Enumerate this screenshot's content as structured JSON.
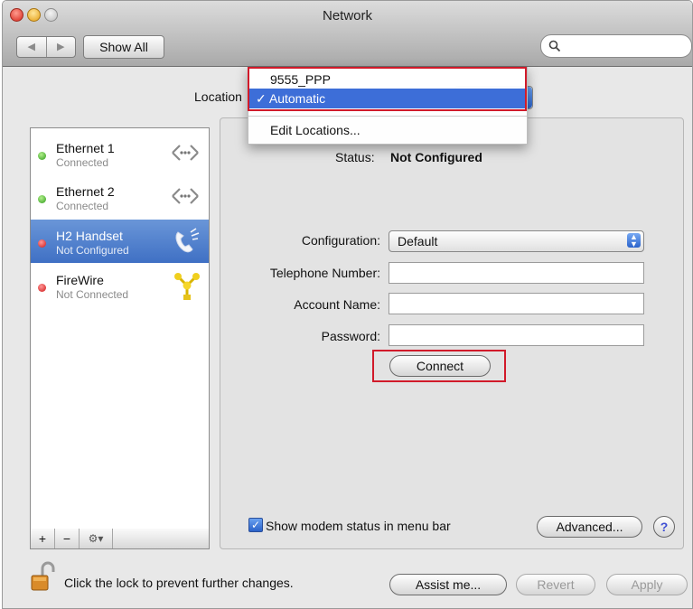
{
  "window": {
    "title": "Network"
  },
  "toolbar": {
    "back": "◀",
    "forward": "▶",
    "show_all": "Show All",
    "search_placeholder": ""
  },
  "location": {
    "label": "Location",
    "menu": {
      "items": [
        "9555_PPP",
        "Automatic",
        "Edit Locations..."
      ],
      "selected": "Automatic",
      "check": "✓"
    }
  },
  "sidebar": {
    "items": [
      {
        "name": "Ethernet 1",
        "status": "Connected",
        "dot": "green",
        "icon": "ethernet-icon"
      },
      {
        "name": "Ethernet 2",
        "status": "Connected",
        "dot": "green",
        "icon": "ethernet-icon"
      },
      {
        "name": "H2 Handset",
        "status": "Not Configured",
        "dot": "red",
        "icon": "phone-icon",
        "selected": true
      },
      {
        "name": "FireWire",
        "status": "Not Connected",
        "dot": "red",
        "icon": "firewire-icon"
      }
    ],
    "add": "+",
    "remove": "−",
    "gear": "⚙▾"
  },
  "detail": {
    "status_label": "Status:",
    "status_value": "Not Configured",
    "configuration_label": "Configuration:",
    "configuration_value": "Default",
    "telephone_label": "Telephone Number:",
    "telephone_value": "",
    "account_label": "Account Name:",
    "account_value": "",
    "password_label": "Password:",
    "password_value": "",
    "connect_button": "Connect",
    "show_modem_status": "Show modem status in menu bar",
    "show_modem_checked": true,
    "advanced_button": "Advanced...",
    "help": "?"
  },
  "footer": {
    "lock_text": "Click the lock to prevent further changes.",
    "assist_button": "Assist me...",
    "revert_button": "Revert",
    "apply_button": "Apply"
  },
  "colors": {
    "highlight": "#d11a2a",
    "selection": "#3d6ed8"
  }
}
